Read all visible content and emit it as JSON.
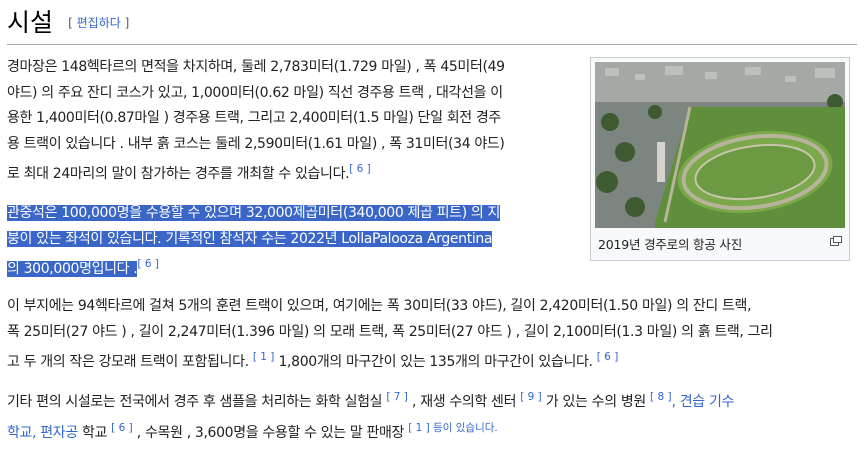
{
  "section": {
    "title": "시설",
    "edit_open": "[",
    "edit_label": "편집하다",
    "edit_close": "]"
  },
  "para1": {
    "lines": [
      "경마장은 148헥타르의 면적을 차지하며, 둘레 2,783미터(1.729 마일) , 폭 45미터(49",
      "야드) 의 주요 잔디 코스가 있고, 1,000미터(0.62 마일) 직선 경주용 트랙 , 대각선을 이",
      "용한 1,400미터(0.87마일 ) 경주용 트랙, 그리고 2,400미터(1.5 마일) 단일 회전 경주",
      "용 트랙이 있습니다 . 내부 흙 코스는 둘레 2,590미터(1.61 마일) , 폭 31미터(34 야드)",
      "로 최대 24마리의 말이 참가하는 경주를 개최할 수 있습니다."
    ],
    "ref": "[ 6 ]"
  },
  "para2": {
    "lines": [
      "관중석은 100,000명을 수용할 수 있으며 32,000제곱미터(340,000 제곱 피트) 의 지",
      "붕이 있는 좌석이 있습니다. 기록적인 참석자 수는 2022년 LollaPalooza Argentina",
      "의 300,000명입니다 ."
    ],
    "ref": "[ 6 ]"
  },
  "para3": {
    "line1": "이 부지에는 94헥타르에 걸쳐 5개의 훈련 트랙이 있으며, 여기에는 폭 30미터(33 야드), 길이 2,420미터(1.50 마일) 의 잔디 트랙,",
    "line2": "폭 25미터(27 야드 ) , 길이 2,247미터(1.396 마일) 의 모래 트랙, 폭 25미터(27 야드 ) , 길이 2,100미터(1.3 마일) 의 흙 트랙, 그리",
    "line3a": "고 두 개의 작은 강모래 트랙이 포함됩니다.",
    "ref_a": "[ 1 ]",
    "line3b": " 1,800개의 마구간이 있는 135개의 마구간이 있습니다.",
    "ref_b": "[ 6 ]"
  },
  "para4": {
    "line1a": "기타 편의 시설로는 전국에서 경주 후 샘플을 처리하는 화학 실험실",
    "ref_a": "[ 7 ]",
    "line1b": " , 재생 수의학 센터",
    "ref_b": "[ 9 ]",
    "line1c": " 가 있는 수의 병원",
    "ref_c": "[ 8 ]",
    "link_1": ", 견습 기수",
    "link_2": "학교, 편자공",
    "line2a": " 학교",
    "ref_d": "[ 6 ]",
    "line2b": " , 수목원 , 3,600명을 수용할 수 있는 말 판매장",
    "ref_e": "[ 1 ]",
    "tail_link": " 등이 있습니다."
  },
  "thumbnail": {
    "caption": "2019년 경주로의 항공 사진",
    "icon": "enlarge-icon",
    "colors": {
      "turf": "#5f8f3a",
      "track": "#b8b49c",
      "city": "#8a8f8c"
    }
  }
}
